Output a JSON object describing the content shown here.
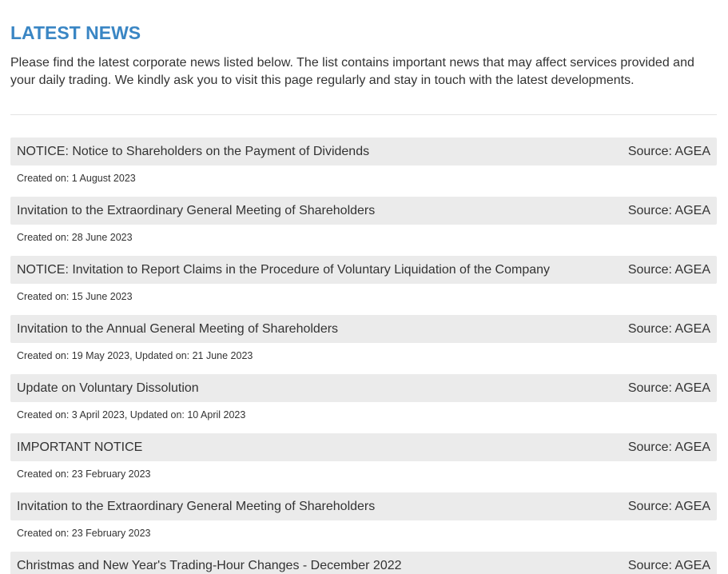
{
  "page": {
    "title": "LATEST NEWS",
    "intro": "Please find the latest corporate news listed below. The list contains important news that may affect services provided and your daily trading. We kindly ask you to visit this page regularly and stay in touch with the latest developments."
  },
  "news": [
    {
      "title": "NOTICE: Notice to Shareholders on the Payment of Dividends",
      "source": "Source: AGEA",
      "meta": "Created on: 1 August 2023"
    },
    {
      "title": "Invitation to the Extraordinary General Meeting of Shareholders",
      "source": "Source: AGEA",
      "meta": "Created on: 28 June 2023"
    },
    {
      "title": "NOTICE: Invitation to Report Claims in the Procedure of Voluntary Liquidation of the Company",
      "source": "Source: AGEA",
      "meta": "Created on: 15 June 2023"
    },
    {
      "title": "Invitation to the Annual General Meeting of Shareholders",
      "source": "Source: AGEA",
      "meta": "Created on: 19 May 2023, Updated on: 21 June 2023"
    },
    {
      "title": "Update on Voluntary Dissolution",
      "source": "Source: AGEA",
      "meta": "Created on: 3 April 2023, Updated on: 10 April 2023"
    },
    {
      "title": "IMPORTANT NOTICE",
      "source": "Source: AGEA",
      "meta": "Created on: 23 February 2023"
    },
    {
      "title": "Invitation to the Extraordinary General Meeting of Shareholders",
      "source": "Source: AGEA",
      "meta": "Created on: 23 February 2023"
    },
    {
      "title": "Christmas and New Year's Trading-Hour Changes - December 2022",
      "source": "Source: AGEA",
      "meta": ""
    }
  ],
  "colors": {
    "heading": "#3a86c4",
    "bar_background": "#ebebeb",
    "text": "#333333",
    "divider": "#e3e3e3"
  }
}
